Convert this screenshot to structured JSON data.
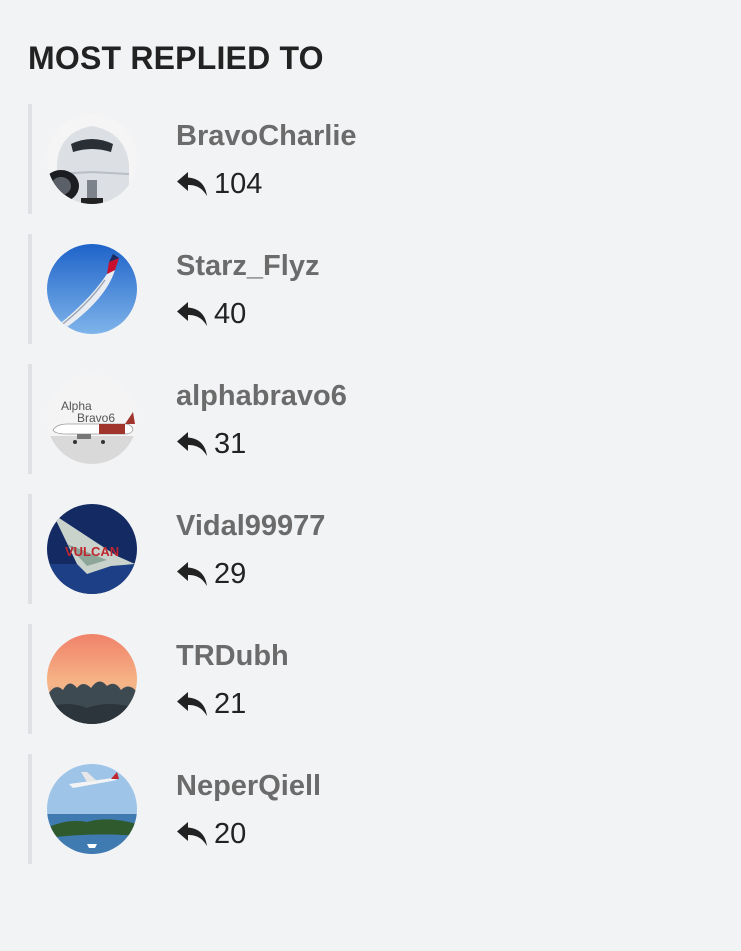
{
  "panel": {
    "title": "MOST REPLIED TO"
  },
  "icons": {
    "reply": "reply-arrow-icon"
  },
  "users": [
    {
      "username": "BravoCharlie",
      "replies": "104",
      "avatar": "airplane-nose-avatar"
    },
    {
      "username": "Starz_Flyz",
      "replies": "40",
      "avatar": "wingtip-sky-avatar"
    },
    {
      "username": "alphabravo6",
      "replies": "31",
      "avatar": "alphabravo6-airliner-avatar",
      "avatar_text_line1": "Alpha",
      "avatar_text_line2": "Bravo6"
    },
    {
      "username": "Vidal99977",
      "replies": "29",
      "avatar": "vulcan-bomber-avatar",
      "avatar_text": "VULCAN"
    },
    {
      "username": "TRDubh",
      "replies": "21",
      "avatar": "sunset-trees-avatar"
    },
    {
      "username": "NeperQiell",
      "replies": "20",
      "avatar": "plane-over-island-avatar"
    }
  ]
}
